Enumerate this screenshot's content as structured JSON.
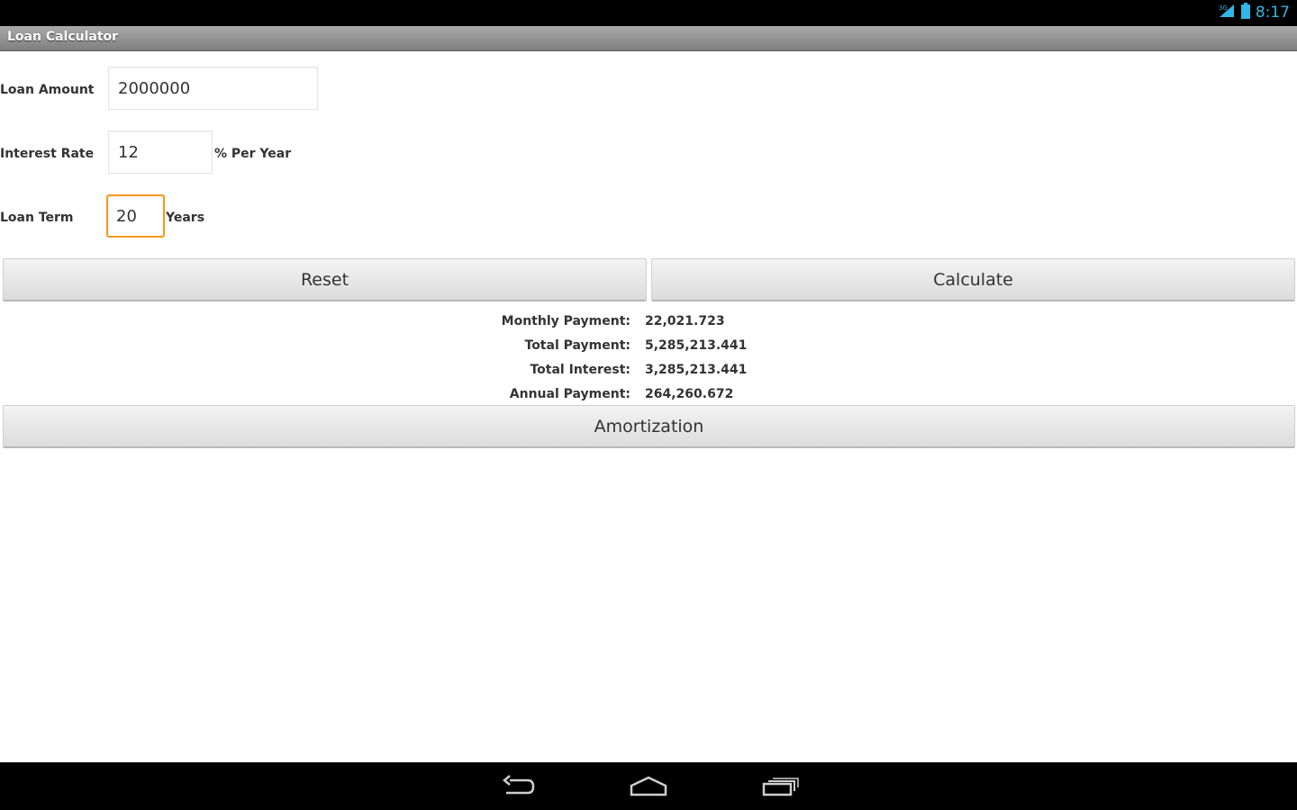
{
  "status": {
    "time": "8:17"
  },
  "app": {
    "title": "Loan Calculator"
  },
  "form": {
    "loan_amount_label": "Loan Amount",
    "loan_amount_value": "2000000",
    "interest_rate_label": "Interest Rate",
    "interest_rate_value": "12",
    "interest_rate_unit": "% Per Year",
    "loan_term_label": "Loan Term",
    "loan_term_value": "20",
    "loan_term_unit": "Years"
  },
  "buttons": {
    "reset": "Reset",
    "calculate": "Calculate",
    "amortization": "Amortization"
  },
  "results": {
    "monthly_payment_label": "Monthly Payment:",
    "monthly_payment_value": "22,021.723",
    "total_payment_label": "Total Payment:",
    "total_payment_value": "5,285,213.441",
    "total_interest_label": "Total Interest:",
    "total_interest_value": "3,285,213.441",
    "annual_payment_label": "Annual Payment:",
    "annual_payment_value": "264,260.672"
  },
  "nav": {
    "icons": [
      "back-icon",
      "home-icon",
      "recent-apps-icon"
    ]
  },
  "colors": {
    "accent_focus": "#f59a20",
    "status_clock": "#33b5e5",
    "title_bar": "#8f8f8f"
  }
}
